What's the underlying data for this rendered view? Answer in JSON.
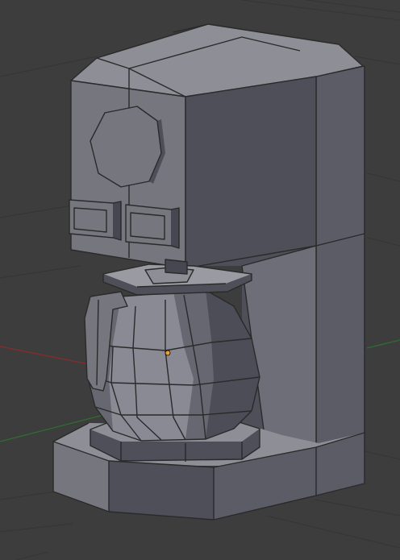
{
  "viewport": {
    "background_color": "#3d3d3d",
    "grid_color": "#353535",
    "x_axis_color": "#8a2a2a",
    "y_axis_color": "#2f6f2f",
    "origin_marker_color": "#f0a030"
  },
  "model": {
    "object": "coffee-maker",
    "face_colors": {
      "top": "#8e8e96",
      "left": "#76767f",
      "front": "#5c5c66",
      "dark": "#4f4f5a"
    }
  }
}
